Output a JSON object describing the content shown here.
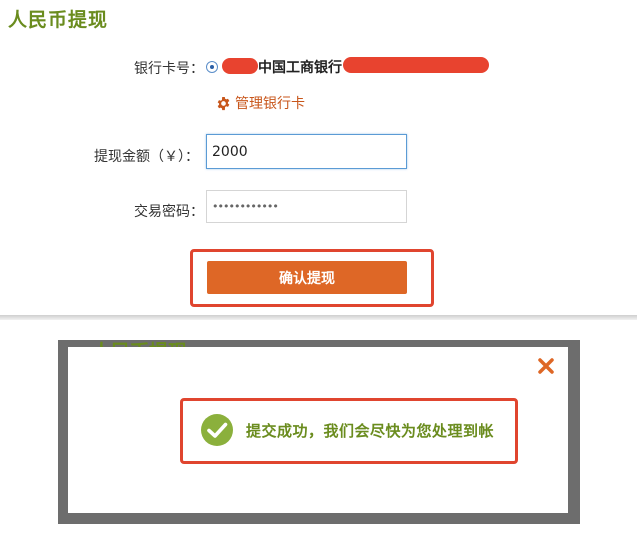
{
  "page": {
    "title": "人民币提现"
  },
  "form": {
    "bank_card_label": "银行卡号：",
    "bank_name": "中国工商银行",
    "manage_cards_link": "管理银行卡",
    "amount_label": "提现金额（￥）：",
    "amount_value": "2000",
    "password_label": "交易密码：",
    "password_mask": "••••••••••••",
    "confirm_button": "确认提现"
  },
  "modal": {
    "success_message": "提交成功，我们会尽快为您处理到帐"
  },
  "colors": {
    "brand_green": "#6a8c1e",
    "accent_orange": "#de6726",
    "annotation_red": "#e0452f",
    "redaction": "#e8432f"
  },
  "icons": {
    "manage": "gear-icon",
    "close": "close-icon",
    "success": "check-circle-icon"
  }
}
